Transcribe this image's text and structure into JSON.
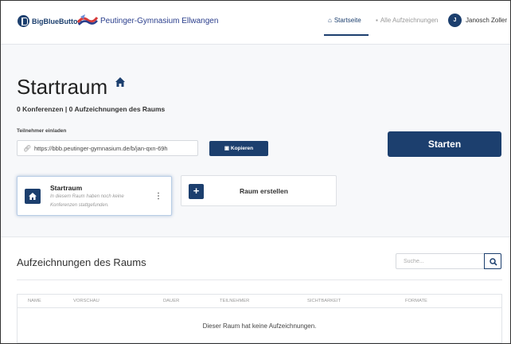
{
  "navbar": {
    "bbb_brand": "BigBlueButton",
    "school_name": "Peutinger-Gymnasium Ellwangen",
    "links": [
      {
        "label": "Startseite",
        "icon": "home-icon"
      },
      {
        "label": "Alle Aufzeichnungen",
        "icon": "video-icon"
      }
    ],
    "user": {
      "initial": "J",
      "name": "Janosch Zoller"
    }
  },
  "room": {
    "title": "Startraum",
    "stats": "0 Konferenzen | 0 Aufzeichnungen des Raums",
    "invite_label": "Teilnehmer einladen",
    "invite_url": "https://bbb.peutinger-gymnasium.de/b/jan-qxn-69h",
    "copy_label": "Kopieren",
    "start_label": "Starten"
  },
  "cards": {
    "room_card": {
      "title": "Startraum",
      "description": "In diesem Raum haben noch keine Konferenzen stattgefunden."
    },
    "create_label": "Raum erstellen"
  },
  "recordings": {
    "title": "Aufzeichnungen des Raums",
    "search_placeholder": "Suche...",
    "columns": [
      "NAME",
      "VORSCHAU",
      "DAUER",
      "TEILNEHMER",
      "SICHTBARKEIT",
      "FORMATE"
    ],
    "empty_message": "Dieser Raum hat keine Aufzeichnungen."
  },
  "colors": {
    "primary": "#1c3f6e",
    "background": "#f7f8fa",
    "card_border_active": "#b8cde6"
  }
}
